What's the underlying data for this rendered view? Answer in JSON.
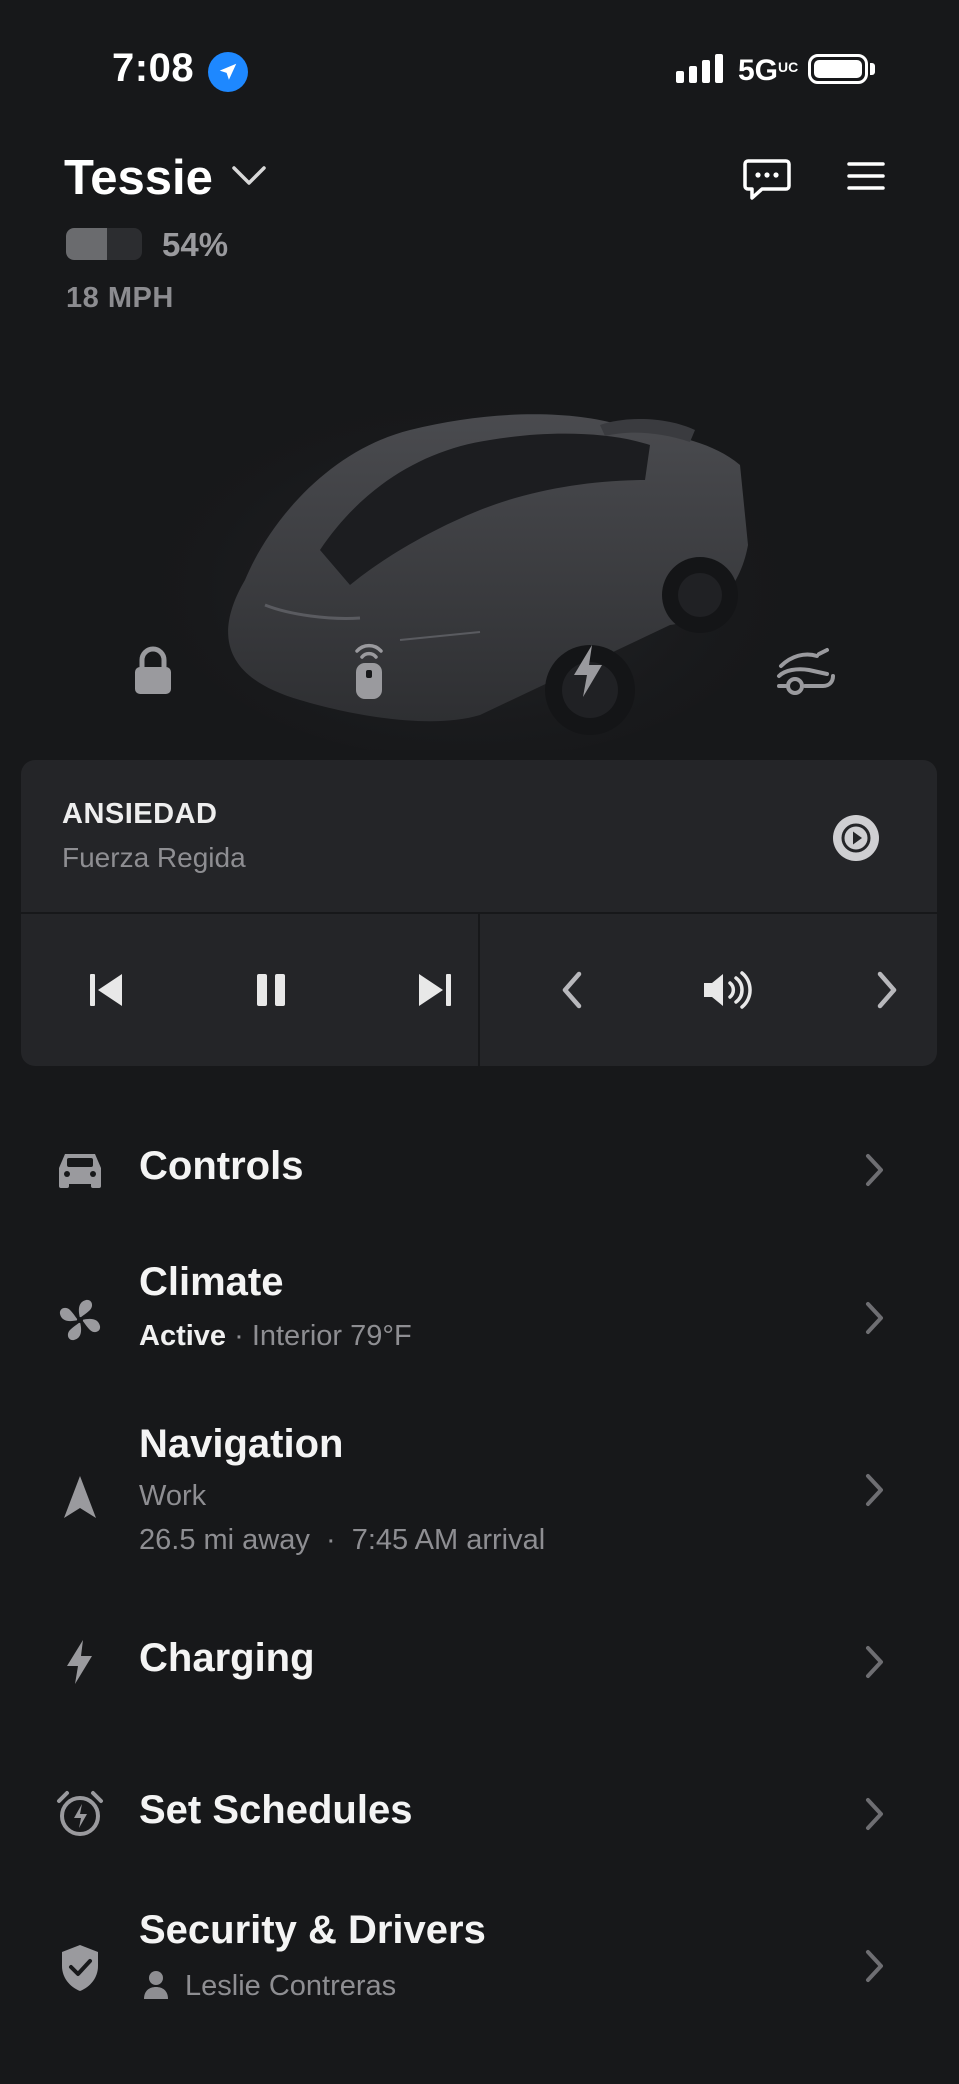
{
  "status_bar": {
    "time": "7:08",
    "network": "5G",
    "network_sup": "UC"
  },
  "vehicle": {
    "name": "Tessie",
    "battery_percent": "54%",
    "battery_level": 0.54,
    "speed": "18 MPH"
  },
  "quick_actions": [
    {
      "name": "lock",
      "icon": "lock-icon"
    },
    {
      "name": "remote",
      "icon": "key-fob-icon"
    },
    {
      "name": "charge",
      "icon": "bolt-icon"
    },
    {
      "name": "frunk",
      "icon": "frunk-icon"
    }
  ],
  "media": {
    "title": "ANSIEDAD",
    "artist": "Fuerza Regida"
  },
  "menu": {
    "controls": {
      "title": "Controls"
    },
    "climate": {
      "title": "Climate",
      "status": "Active",
      "detail": " · Interior 79°F"
    },
    "navigation": {
      "title": "Navigation",
      "destination": "Work",
      "eta": "26.5 mi away  ·  7:45 AM arrival"
    },
    "charging": {
      "title": "Charging"
    },
    "schedules": {
      "title": "Set Schedules"
    },
    "security": {
      "title": "Security & Drivers",
      "driver": "Leslie Contreras"
    }
  },
  "colors": {
    "background": "#17181a",
    "card": "#242528",
    "accent_blue": "#1e88ff",
    "muted_text": "#8e8e92"
  }
}
